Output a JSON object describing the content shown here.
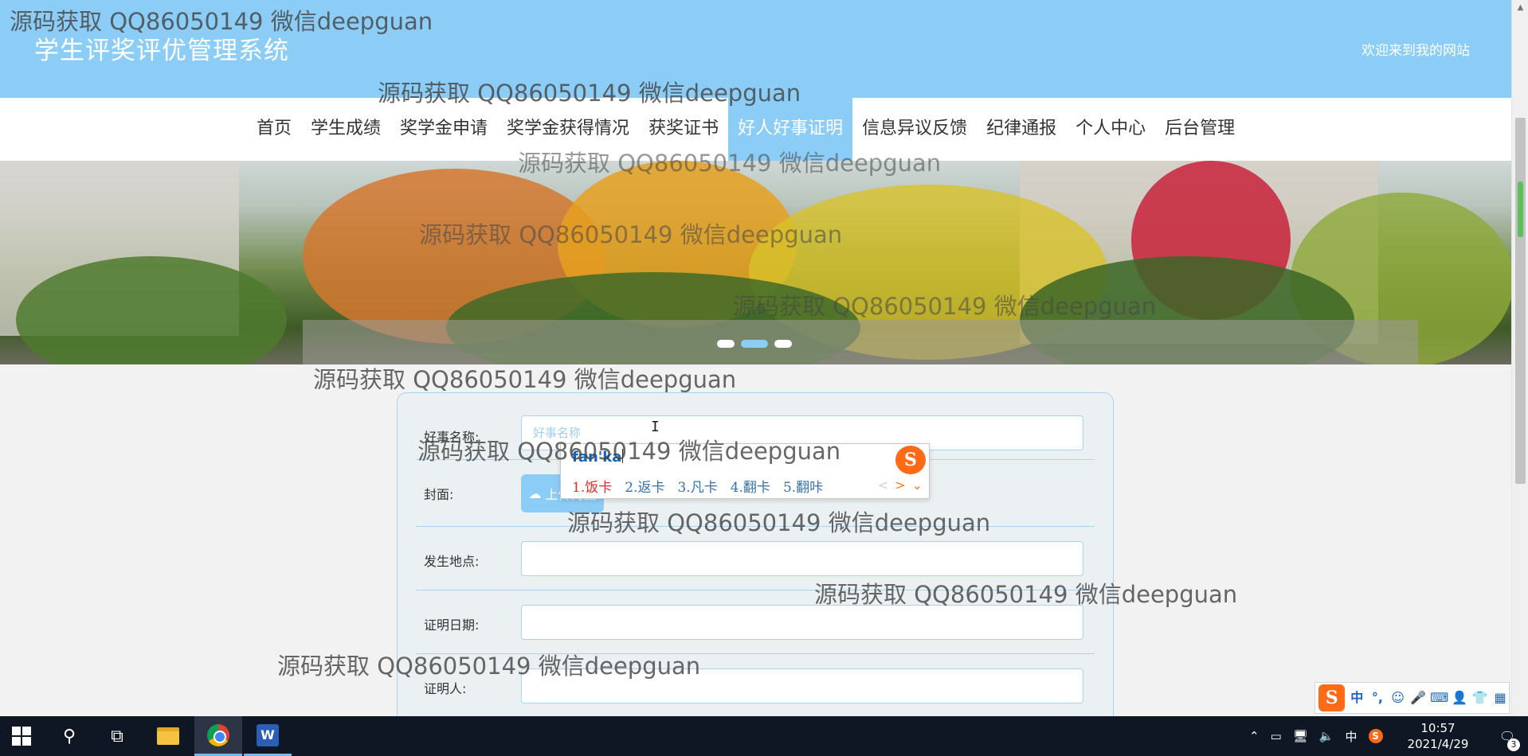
{
  "header": {
    "site_title": "学生评奖评优管理系统",
    "welcome": "欢迎来到我的网站"
  },
  "nav": {
    "items": [
      "首页",
      "学生成绩",
      "奖学金申请",
      "奖学金获得情况",
      "获奖证书",
      "好人好事证明",
      "信息异议反馈",
      "纪律通报",
      "个人中心",
      "后台管理"
    ],
    "active_index": 5
  },
  "banner": {
    "slide_count": 3,
    "active_slide": 2
  },
  "form": {
    "fields": {
      "name": {
        "label": "好事名称:",
        "placeholder": "好事名称"
      },
      "cover": {
        "label": "封面:",
        "button": "上传封面"
      },
      "location": {
        "label": "发生地点:",
        "value": ""
      },
      "date": {
        "label": "证明日期:",
        "value": ""
      },
      "witness": {
        "label": "证明人:",
        "value": ""
      }
    }
  },
  "ime_popup": {
    "pinyin": "fan'ka",
    "candidates": [
      "1.饭卡",
      "2.返卡",
      "3.凡卡",
      "4.翻卡",
      "5.翻咔"
    ],
    "logo": "S"
  },
  "watermark_text": "源码获取 QQ86050149 微信deepguan",
  "ime_toolbar": {
    "logo": "S",
    "mode": "中",
    "punct": "°,"
  },
  "taskbar": {
    "apps": [
      "start-icon",
      "search-icon",
      "task-view-icon",
      "file-explorer-icon",
      "chrome-icon",
      "word-icon"
    ],
    "tray_lang": "中",
    "time": "10:57",
    "date": "2021/4/29",
    "notifications": "3"
  },
  "colors": {
    "accent": "#8ccdf7",
    "form_border": "#a6d4f2",
    "taskbar": "#0f1724"
  }
}
